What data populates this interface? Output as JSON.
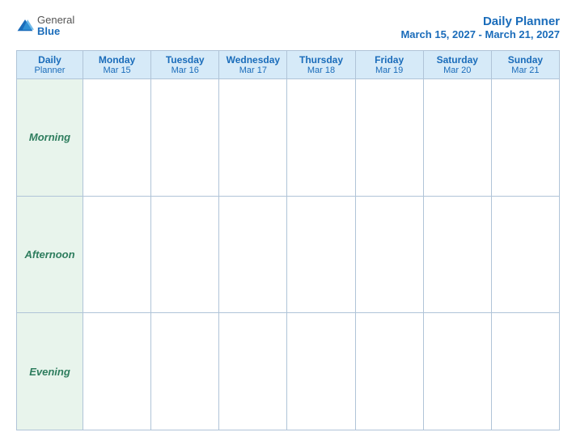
{
  "logo": {
    "general": "General",
    "blue": "Blue",
    "icon": "▶"
  },
  "title": {
    "main": "Daily Planner",
    "sub": "March 15, 2027 - March 21, 2027"
  },
  "header_col": {
    "line1": "Daily",
    "line2": "Planner"
  },
  "days": [
    {
      "name": "Monday",
      "date": "Mar 15"
    },
    {
      "name": "Tuesday",
      "date": "Mar 16"
    },
    {
      "name": "Wednesday",
      "date": "Mar 17"
    },
    {
      "name": "Thursday",
      "date": "Mar 18"
    },
    {
      "name": "Friday",
      "date": "Mar 19"
    },
    {
      "name": "Saturday",
      "date": "Mar 20"
    },
    {
      "name": "Sunday",
      "date": "Mar 21"
    }
  ],
  "rows": [
    {
      "label": "Morning"
    },
    {
      "label": "Afternoon"
    },
    {
      "label": "Evening"
    }
  ]
}
